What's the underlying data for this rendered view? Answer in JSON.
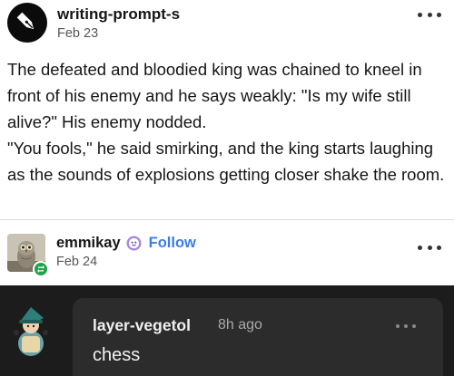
{
  "post": {
    "author": "writing-prompt-s",
    "date": "Feb 23",
    "paragraphs": [
      "The defeated and bloodied king was chained to kneel in front of his enemy and he says weakly: \"Is my wife still alive?\" His enemy nodded.",
      "\"You fools,\" he said smirking, and the king starts laughing as the sounds of explosions getting closer shake the room."
    ],
    "avatar_icon": "pen-nib-icon",
    "more_icon": "more-options-icon"
  },
  "reblog": {
    "author": "emmikay",
    "follow_label": "Follow",
    "date": "Feb 24",
    "badge_icon": "reblog-icon",
    "accent_color": "#3b7de6",
    "badge_color": "#1fa24a"
  },
  "comment": {
    "author": "layer-vegetol",
    "time": "8h ago",
    "text": "chess",
    "background": "#1c1c1c",
    "bubble_color": "#2c2c2c"
  }
}
